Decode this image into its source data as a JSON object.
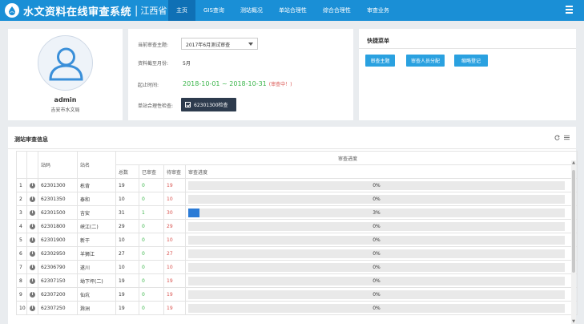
{
  "header": {
    "title": "水文资料在线审查系统",
    "separator": "|",
    "province": "江西省",
    "nav": [
      {
        "label": "主页",
        "active": true
      },
      {
        "label": "GIS查询",
        "active": false
      },
      {
        "label": "测站概况",
        "active": false
      },
      {
        "label": "单站合理性",
        "active": false
      },
      {
        "label": "综合合理性",
        "active": false
      },
      {
        "label": "审查业务",
        "active": false
      }
    ],
    "brand_color": "#1a8fd6"
  },
  "profile": {
    "username": "admin",
    "organization": "吉安市水文局",
    "avatar_icon": "user-avatar-icon"
  },
  "review": {
    "topic_label": "当前审查主题:",
    "topic_value": "2017年6月测试审查",
    "data_month_label": "资料截至月份:",
    "data_month_value": "5月",
    "deadline_label": "起止时间:",
    "deadline_value": "2018-10-01 ~ 2018-10-31",
    "deadline_status": "(审查中！)",
    "check_label": "单站合理性检查:",
    "check_button": "62301300检查"
  },
  "quick_menu": {
    "title": "快捷菜单",
    "buttons": [
      "审查主题",
      "审查人员分配",
      "缩略登记"
    ]
  },
  "table": {
    "title": "测站审查信息",
    "icons": [
      "refresh-icon",
      "list-icon"
    ],
    "headers": {
      "station_code": "站码",
      "station_name": "站名",
      "progress_group": "审查进度",
      "total": "总数",
      "reviewed": "已审查",
      "pending": "待审查",
      "progress": "审查进度"
    },
    "rows": [
      {
        "index": "1",
        "code": "62301300",
        "name": "栋背",
        "total": "19",
        "reviewed": "0",
        "pending": "19",
        "progress": 0,
        "progress_text": "0%"
      },
      {
        "index": "2",
        "code": "62301350",
        "name": "泰和",
        "total": "10",
        "reviewed": "0",
        "pending": "10",
        "progress": 0,
        "progress_text": "0%"
      },
      {
        "index": "3",
        "code": "62301500",
        "name": "吉安",
        "total": "31",
        "reviewed": "1",
        "pending": "30",
        "progress": 3,
        "progress_text": "3%"
      },
      {
        "index": "4",
        "code": "62301800",
        "name": "峡江(二)",
        "total": "29",
        "reviewed": "0",
        "pending": "29",
        "progress": 0,
        "progress_text": "0%"
      },
      {
        "index": "5",
        "code": "62301900",
        "name": "新干",
        "total": "10",
        "reviewed": "0",
        "pending": "10",
        "progress": 0,
        "progress_text": "0%"
      },
      {
        "index": "6",
        "code": "62302950",
        "name": "羊狮江",
        "total": "27",
        "reviewed": "0",
        "pending": "27",
        "progress": 0,
        "progress_text": "0%"
      },
      {
        "index": "7",
        "code": "62306790",
        "name": "遂川",
        "total": "10",
        "reviewed": "0",
        "pending": "10",
        "progress": 0,
        "progress_text": "0%"
      },
      {
        "index": "8",
        "code": "62307150",
        "name": "坳下坪(二)",
        "total": "19",
        "reviewed": "0",
        "pending": "19",
        "progress": 0,
        "progress_text": "0%"
      },
      {
        "index": "9",
        "code": "62307200",
        "name": "仙坑",
        "total": "19",
        "reviewed": "0",
        "pending": "19",
        "progress": 0,
        "progress_text": "0%"
      },
      {
        "index": "10",
        "code": "62307250",
        "name": "滁洲",
        "total": "19",
        "reviewed": "0",
        "pending": "19",
        "progress": 0,
        "progress_text": "0%"
      }
    ]
  }
}
